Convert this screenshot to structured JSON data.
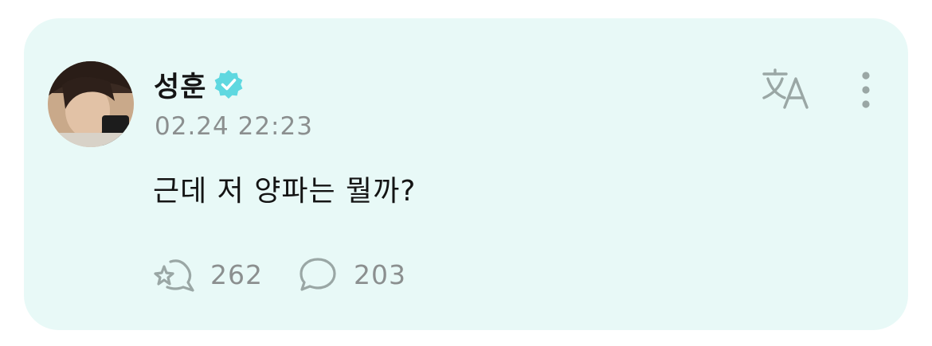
{
  "post": {
    "author_name": "성훈",
    "verified": true,
    "timestamp": "02.24 22:23",
    "message": "근데 저 양파는 뭘까?",
    "icons": {
      "avatar": "user-avatar-photo",
      "verified": "verified-badge-icon",
      "translate": "translate-icon",
      "more": "more-vertical-icon",
      "like": "sparkle-heart-icon",
      "comment": "comment-bubble-icon"
    },
    "stats": {
      "likes": "262",
      "comments": "203"
    }
  },
  "colors": {
    "card_background": "#e8f9f7",
    "verified_badge": "#5fd8e0",
    "muted_text": "#8b8f8f",
    "icon_gray": "#9aa7a5"
  }
}
